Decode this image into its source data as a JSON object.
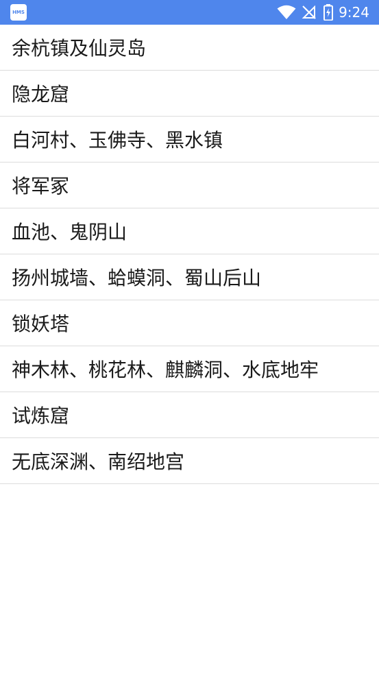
{
  "status_bar": {
    "app_badge_text": "HMS",
    "time": "9:24",
    "icons": [
      "wifi-icon",
      "no-signal-icon",
      "battery-charging-icon"
    ],
    "background_color": "#4f86ec"
  },
  "list": {
    "items": [
      {
        "label": "余杭镇及仙灵岛"
      },
      {
        "label": "隐龙窟"
      },
      {
        "label": "白河村、玉佛寺、黑水镇"
      },
      {
        "label": "将军冢"
      },
      {
        "label": "血池、鬼阴山"
      },
      {
        "label": "扬州城墙、蛤蟆洞、蜀山后山"
      },
      {
        "label": "锁妖塔"
      },
      {
        "label": "神木林、桃花林、麒麟洞、水底地牢"
      },
      {
        "label": "试炼窟"
      },
      {
        "label": "无底深渊、南绍地宫"
      }
    ]
  }
}
